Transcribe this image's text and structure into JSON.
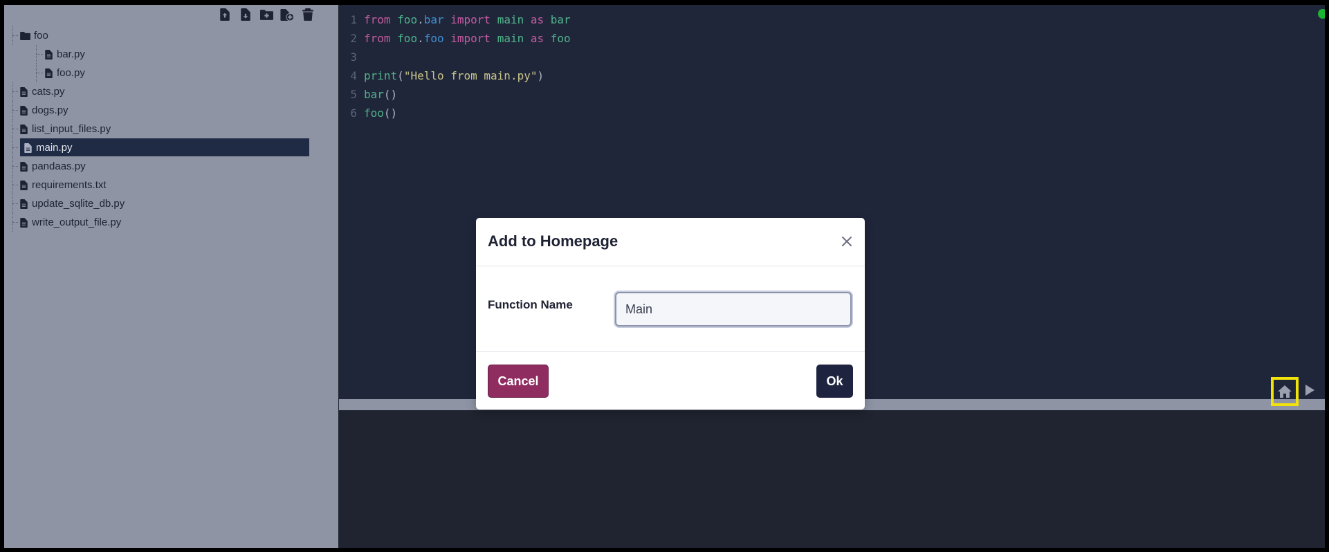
{
  "toolbar": {
    "buttons": [
      {
        "icon": "file-upload-icon"
      },
      {
        "icon": "file-download-icon"
      },
      {
        "icon": "folder-plus-icon"
      },
      {
        "icon": "file-plus-icon"
      },
      {
        "icon": "trash-icon"
      }
    ]
  },
  "file_tree": {
    "items": [
      {
        "label": "foo",
        "type": "folder",
        "depth": 0
      },
      {
        "label": "bar.py",
        "type": "file",
        "depth": 1
      },
      {
        "label": "foo.py",
        "type": "file",
        "depth": 1
      },
      {
        "label": "cats.py",
        "type": "file",
        "depth": 0
      },
      {
        "label": "dogs.py",
        "type": "file",
        "depth": 0
      },
      {
        "label": "list_input_files.py",
        "type": "file",
        "depth": 0
      },
      {
        "label": "main.py",
        "type": "file",
        "depth": 0,
        "selected": true
      },
      {
        "label": "pandaas.py",
        "type": "file",
        "depth": 0
      },
      {
        "label": "requirements.txt",
        "type": "file",
        "depth": 0
      },
      {
        "label": "update_sqlite_db.py",
        "type": "file",
        "depth": 0
      },
      {
        "label": "write_output_file.py",
        "type": "file",
        "depth": 0
      }
    ]
  },
  "editor": {
    "lines": [
      {
        "n": "1",
        "tokens": [
          [
            "kw",
            "from"
          ],
          [
            "sp",
            " "
          ],
          [
            "mod",
            "foo"
          ],
          [
            "punc",
            "."
          ],
          [
            "attr",
            "bar"
          ],
          [
            "sp",
            " "
          ],
          [
            "kw",
            "import"
          ],
          [
            "sp",
            " "
          ],
          [
            "mod",
            "main"
          ],
          [
            "sp",
            " "
          ],
          [
            "kw",
            "as"
          ],
          [
            "sp",
            " "
          ],
          [
            "mod",
            "bar"
          ]
        ]
      },
      {
        "n": "2",
        "tokens": [
          [
            "kw",
            "from"
          ],
          [
            "sp",
            " "
          ],
          [
            "mod",
            "foo"
          ],
          [
            "punc",
            "."
          ],
          [
            "attr",
            "foo"
          ],
          [
            "sp",
            " "
          ],
          [
            "kw",
            "import"
          ],
          [
            "sp",
            " "
          ],
          [
            "mod",
            "main"
          ],
          [
            "sp",
            " "
          ],
          [
            "kw",
            "as"
          ],
          [
            "sp",
            " "
          ],
          [
            "mod",
            "foo"
          ]
        ]
      },
      {
        "n": "3",
        "tokens": []
      },
      {
        "n": "4",
        "tokens": [
          [
            "fn",
            "print"
          ],
          [
            "punc",
            "("
          ],
          [
            "str",
            "\"Hello from main.py\""
          ],
          [
            "punc",
            ")"
          ]
        ]
      },
      {
        "n": "5",
        "tokens": [
          [
            "fn",
            "bar"
          ],
          [
            "punc",
            "()"
          ]
        ]
      },
      {
        "n": "6",
        "tokens": [
          [
            "fn",
            "foo"
          ],
          [
            "punc",
            "()"
          ]
        ]
      }
    ],
    "status_color": "#1db333"
  },
  "actions": {
    "home_icon": "home-icon",
    "run_icon": "play-icon",
    "highlight_color": "#f2e20b"
  },
  "modal": {
    "title": "Add to Homepage",
    "field_label": "Function Name",
    "field_value": "Main",
    "cancel_label": "Cancel",
    "ok_label": "Ok"
  },
  "colors": {
    "sidebar_bg": "#8e94a4",
    "editor_bg": "#20263a",
    "selected_bg": "#1f2a44",
    "cancel_bg": "#8f2c60",
    "ok_bg": "#1e2440"
  }
}
